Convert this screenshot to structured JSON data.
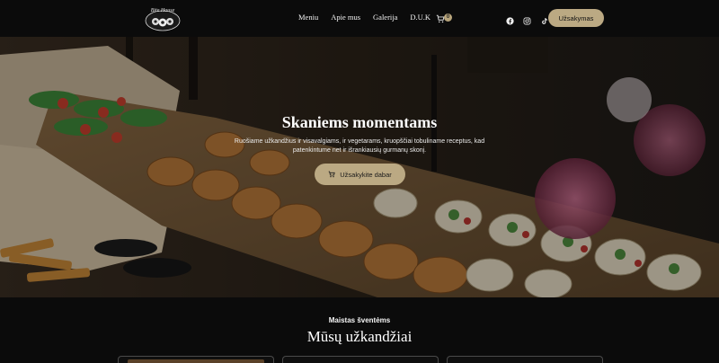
{
  "brand": {
    "logo_text": "Bite House"
  },
  "nav": {
    "items": [
      {
        "label": "Meniu"
      },
      {
        "label": "Apie mus"
      },
      {
        "label": "Galerija"
      },
      {
        "label": "D.U.K"
      }
    ],
    "cart_count": "0",
    "order_label": "Užsakymas",
    "social": [
      "facebook-icon",
      "instagram-icon",
      "tiktok-icon"
    ]
  },
  "hero": {
    "title": "Skaniems momentams",
    "text": "Ruošiame užkandžius ir visavalgiams, ir vegetarams, kruopščiai tobuliname receptus, kad patenkintume net ir išrankiausių gurmanų skonį.",
    "cta_label": "Užsakykite dabar"
  },
  "section": {
    "subtitle": "Maistas šventėms",
    "title": "Mūsų užkandžiai"
  },
  "colors": {
    "accent": "#bba983",
    "background": "#0b0b0b"
  }
}
